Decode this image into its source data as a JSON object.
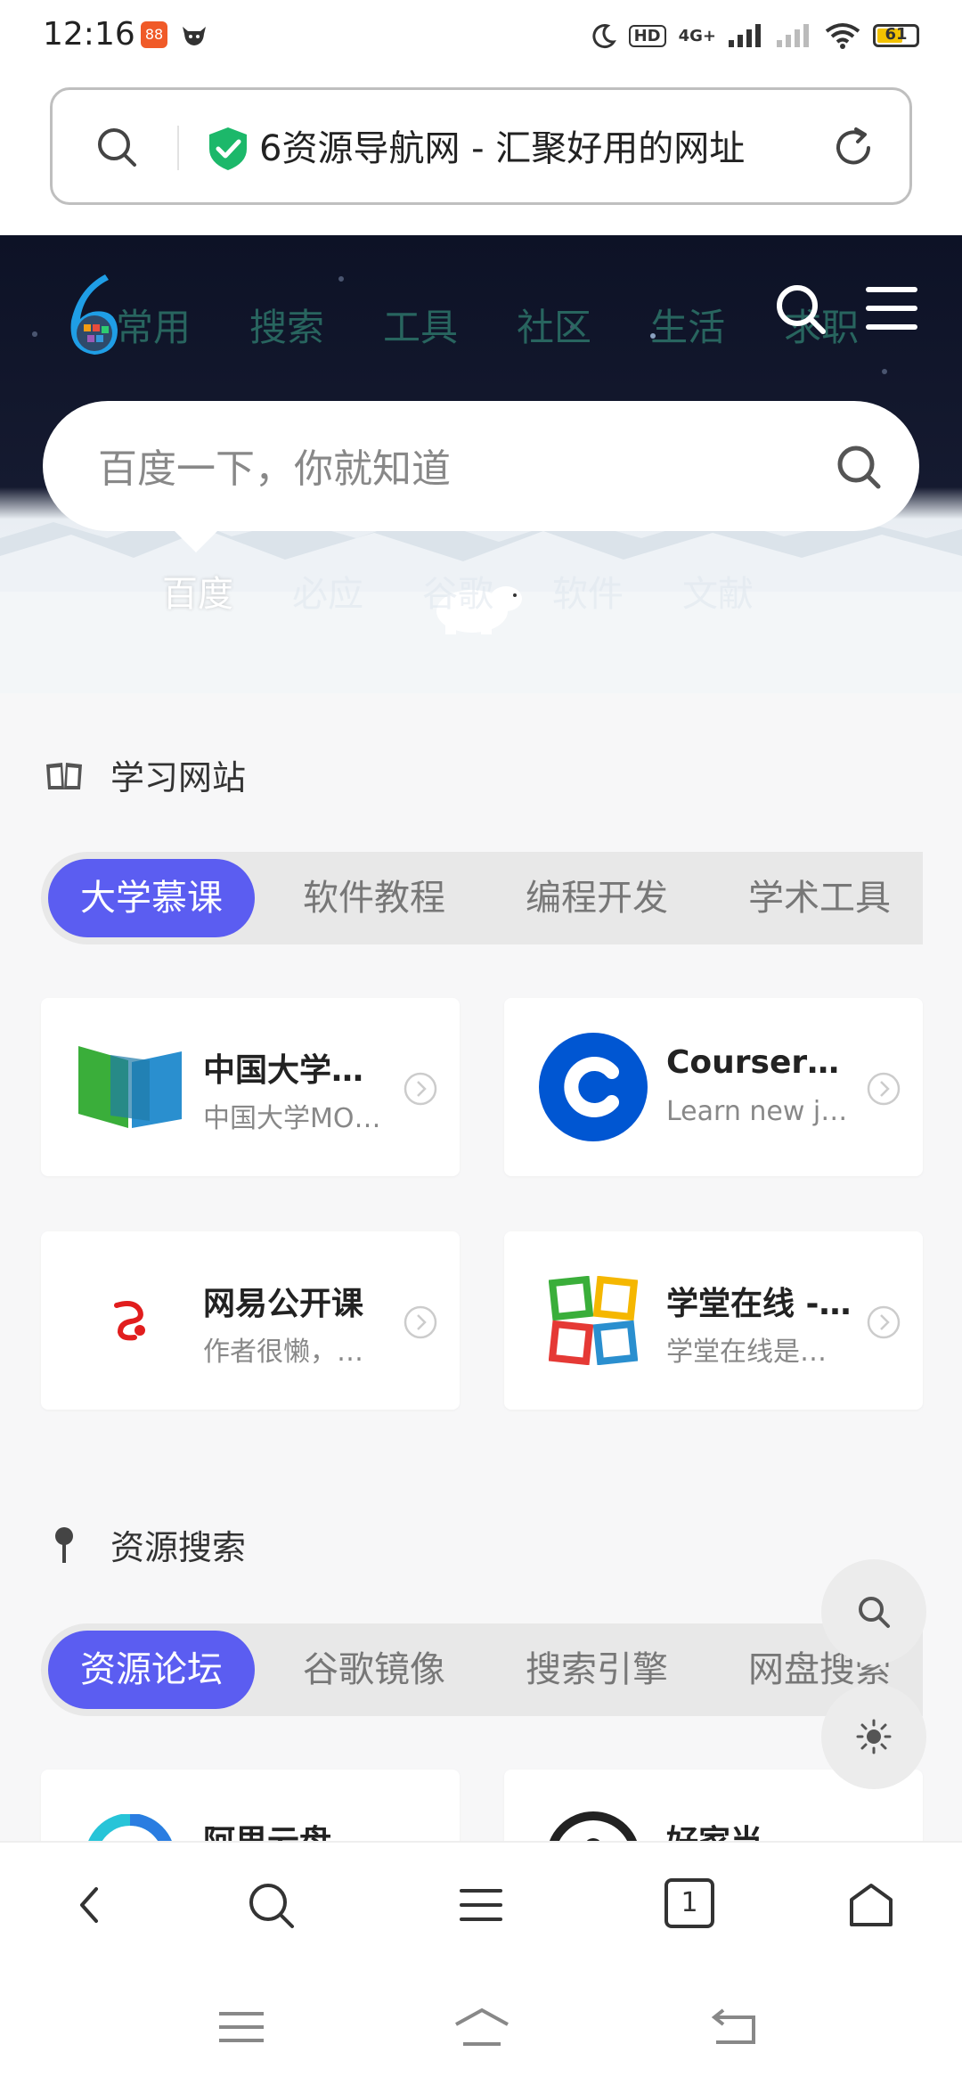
{
  "status_bar": {
    "time": "12:16",
    "app_badge": "88",
    "hd_label": "HD",
    "network": "4G+",
    "battery": "61"
  },
  "address_bar": {
    "title": "6资源导航网 - 汇聚好用的网址",
    "shield_color": "#1cb86a"
  },
  "hero": {
    "nav": [
      "常用",
      "搜索",
      "工具",
      "社区",
      "生活",
      "求职"
    ],
    "search_placeholder": "百度一下，你就知道",
    "engine_tabs": [
      "百度",
      "必应",
      "谷歌",
      "软件",
      "文献"
    ],
    "active_engine": "百度"
  },
  "section_study": {
    "title": "学习网站",
    "tabs": [
      "大学慕课",
      "软件教程",
      "编程开发",
      "学术工具"
    ],
    "active_tab": "大学慕课",
    "cards": [
      {
        "title": "中国大学…",
        "desc": "中国大学MO…"
      },
      {
        "title": "Coursera |…",
        "desc": "Learn new j…"
      },
      {
        "title": "网易公开课",
        "desc": "作者很懒，…"
      },
      {
        "title": "学堂在线 -…",
        "desc": "学堂在线是…"
      }
    ]
  },
  "section_search": {
    "title": "资源搜索",
    "tabs": [
      "资源论坛",
      "谷歌镜像",
      "搜索引擎",
      "网盘搜索"
    ],
    "active_tab": "资源论坛",
    "cards": [
      {
        "title": "阿里云盘资源"
      },
      {
        "title": "好家当 -…"
      }
    ]
  },
  "toolbar": {
    "tab_count": "1"
  },
  "colors": {
    "accent": "#5b5df1",
    "hero_bg": "#0d1226"
  }
}
